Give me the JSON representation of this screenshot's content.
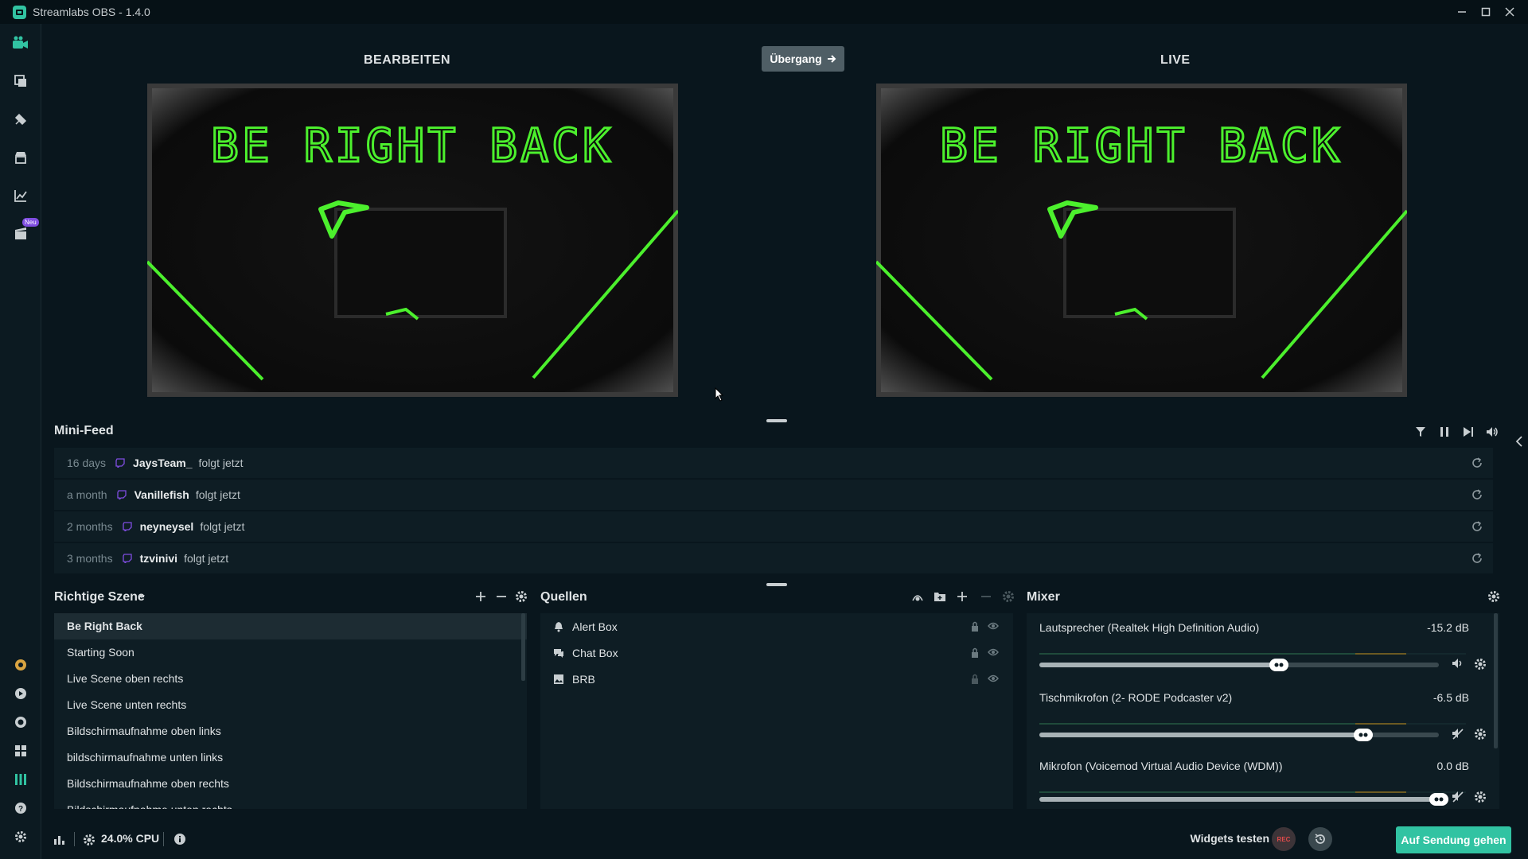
{
  "window": {
    "title": "Streamlabs OBS - 1.4.0"
  },
  "editor": {
    "edit_label": "BEARBEITEN",
    "live_label": "LIVE",
    "transition_label": "Übergang",
    "preview_text": "BE RIGHT BACK"
  },
  "nav": {
    "badge": "Neu"
  },
  "minifeed": {
    "title": "Mini-Feed",
    "items": [
      {
        "time": "16 days",
        "name": "JaysTeam_",
        "action": "folgt jetzt"
      },
      {
        "time": "a month",
        "name": "Vanillefish",
        "action": "folgt jetzt"
      },
      {
        "time": "2 months",
        "name": "neyneysel",
        "action": "folgt jetzt"
      },
      {
        "time": "3 months",
        "name": "tzvinivi",
        "action": "folgt jetzt"
      }
    ]
  },
  "scenes": {
    "title": "Richtige Szene",
    "items": [
      "Be Right Back",
      "Starting Soon",
      "Live Scene oben rechts",
      "Live Scene unten rechts",
      "Bildschirmaufnahme oben links",
      "bildschirmaufnahme unten links",
      "Bildschirmaufnahme oben rechts",
      "Bildschirmaufnahme unten rechts"
    ]
  },
  "sources": {
    "title": "Quellen",
    "items": [
      {
        "label": "Alert Box",
        "icon": "bell-icon"
      },
      {
        "label": "Chat Box",
        "icon": "chat-icon"
      },
      {
        "label": "BRB",
        "icon": "image-icon"
      }
    ]
  },
  "mixer": {
    "title": "Mixer",
    "channels": [
      {
        "name": "Lautsprecher (Realtek High Definition Audio)",
        "db": "-15.2 dB",
        "level": 0.6,
        "muted": false
      },
      {
        "name": "Tischmikrofon (2- RODE Podcaster v2)",
        "db": "-6.5 dB",
        "level": 0.81,
        "muted": true
      },
      {
        "name": "Mikrofon (Voicemod Virtual Audio Device (WDM))",
        "db": "0.0 dB",
        "level": 1.0,
        "muted": true
      }
    ]
  },
  "footer": {
    "cpu": "24.0% CPU",
    "widgets_test": "Widgets testen",
    "rec_label": "REC",
    "go_live": "Auf Sendung gehen"
  },
  "colors": {
    "accent": "#31c3a2",
    "neon": "#4cf02d",
    "background": "#09161d",
    "panel": "#0e1d24"
  }
}
